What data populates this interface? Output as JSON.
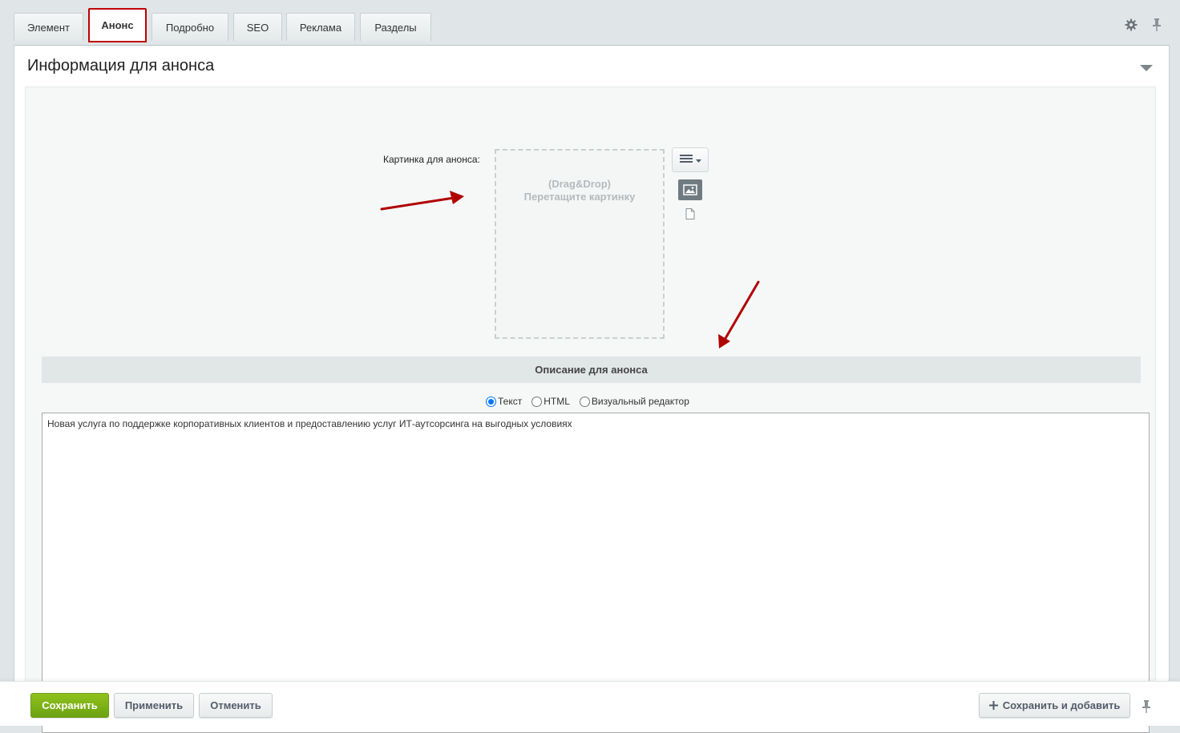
{
  "tabs": [
    {
      "label": "Элемент"
    },
    {
      "label": "Анонс"
    },
    {
      "label": "Подробно"
    },
    {
      "label": "SEO"
    },
    {
      "label": "Реклама"
    },
    {
      "label": "Разделы"
    }
  ],
  "active_tab": "Анонс",
  "header_icons": [
    "gear-icon",
    "pin-icon"
  ],
  "card": {
    "title": "Информация для анонса"
  },
  "image_field": {
    "label": "Картинка для анонса:",
    "drop_line1": "(Drag&Drop)",
    "drop_line2": "Перетащите картинку"
  },
  "description": {
    "section_title": "Описание для анонса",
    "modes": [
      "Текст",
      "HTML",
      "Визуальный редактор"
    ],
    "selected_mode": "Текст",
    "text": "Новая услуга по поддержке корпоративных клиентов и предоставлению услуг ИТ-аутсорсинга на выгодных условиях"
  },
  "footer": {
    "save": "Сохранить",
    "apply": "Применить",
    "cancel": "Отменить",
    "save_add": "Сохранить и добавить"
  },
  "colors": {
    "accent_green": "#7bb41a",
    "active_tab_border": "#c00000",
    "annotation_arrow": "#b00000"
  }
}
